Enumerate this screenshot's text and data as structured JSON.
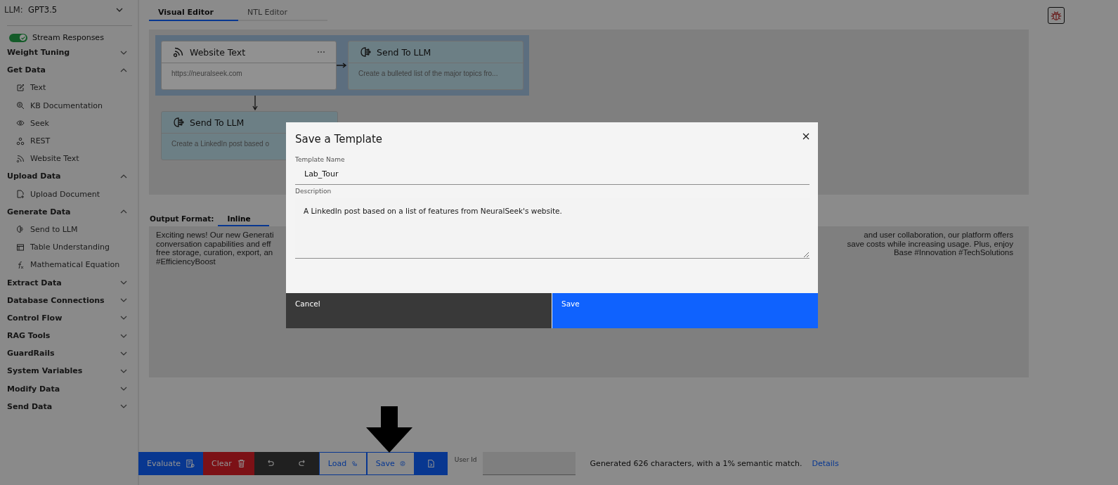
{
  "sidebar": {
    "llm_label": "LLM:",
    "llm_value": "GPT3.5",
    "stream_toggle": {
      "label": "Stream Responses",
      "on": true
    },
    "sections": [
      {
        "label": "Weight Tuning",
        "expanded": false
      },
      {
        "label": "Get Data",
        "expanded": true,
        "children": [
          {
            "label": "Text"
          },
          {
            "label": "KB Documentation"
          },
          {
            "label": "Seek"
          },
          {
            "label": "REST"
          },
          {
            "label": "Website Text"
          }
        ]
      },
      {
        "label": "Upload Data",
        "expanded": true,
        "children": [
          {
            "label": "Upload Document"
          }
        ]
      },
      {
        "label": "Generate Data",
        "expanded": true,
        "children": [
          {
            "label": "Send to LLM"
          },
          {
            "label": "Table Understanding"
          },
          {
            "label": "Mathematical Equation"
          }
        ]
      },
      {
        "label": "Extract Data",
        "expanded": false
      },
      {
        "label": "Database Connections",
        "expanded": false
      },
      {
        "label": "Control Flow",
        "expanded": false
      },
      {
        "label": "RAG Tools",
        "expanded": false
      },
      {
        "label": "GuardRails",
        "expanded": false
      },
      {
        "label": "System Variables",
        "expanded": false
      },
      {
        "label": "Modify Data",
        "expanded": false
      },
      {
        "label": "Send Data",
        "expanded": false
      }
    ]
  },
  "editor_tabs": [
    {
      "label": "Visual Editor",
      "selected": true
    },
    {
      "label": "NTL Editor",
      "selected": false
    }
  ],
  "canvas": {
    "selected_group": [
      {
        "kind": "source",
        "title": "Website Text",
        "body": "https://neuralseek.com"
      },
      {
        "kind": "llm",
        "title": "Send To LLM",
        "body": "Create a bulleted list of the major topics fro..."
      }
    ],
    "other_nodes": [
      {
        "kind": "llm",
        "title": "Send To LLM",
        "body": "Create a LinkedIn post based o"
      }
    ]
  },
  "output": {
    "label": "Output Format:",
    "tabs": [
      {
        "label": "Inline",
        "selected": true
      }
    ],
    "lines": [
      {
        "left": "Exciting news! Our new Generati",
        "right": "and user collaboration, our platform offers"
      },
      {
        "left": "conversation capabilities and eff",
        "right": "save costs while increasing usage. Plus, enjoy"
      },
      {
        "left": "free storage, curation, export, an",
        "right": "Base #Innovation #TechSolutions"
      },
      {
        "left": "#EfficiencyBoost"
      }
    ]
  },
  "toolbar": [
    {
      "kind": "evaluate",
      "label": "Evaluate"
    },
    {
      "kind": "clear",
      "label": "Clear"
    },
    {
      "kind": "undo"
    },
    {
      "kind": "redo"
    },
    {
      "kind": "load",
      "label": "Load"
    },
    {
      "kind": "save",
      "label": "Save"
    },
    {
      "kind": "export"
    }
  ],
  "user_id": {
    "label": "User Id"
  },
  "status": {
    "text": "Generated 626 characters, with a 1% semantic match.",
    "link": "Details"
  },
  "modal": {
    "title": "Save a Template",
    "name_label": "Template Name",
    "name_value": "Lab_Tour",
    "description_label": "Description",
    "description_value": "A LinkedIn post based on a list of features from NeuralSeek's website.",
    "buttons": [
      {
        "kind": "secondary",
        "label": "Cancel"
      },
      {
        "kind": "primary",
        "label": "Save"
      }
    ]
  }
}
